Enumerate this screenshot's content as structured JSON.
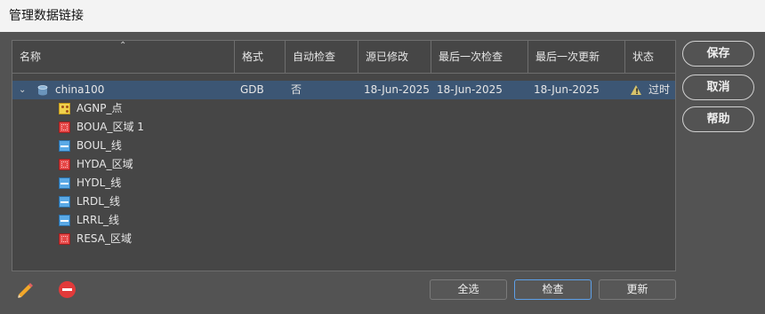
{
  "window": {
    "title": "管理数据链接"
  },
  "table": {
    "columns": [
      {
        "label": "名称"
      },
      {
        "label": "格式"
      },
      {
        "label": "自动检查"
      },
      {
        "label": "源已修改"
      },
      {
        "label": "最后一次检查"
      },
      {
        "label": "最后一次更新"
      },
      {
        "label": "状态"
      }
    ],
    "parent": {
      "name": "china100",
      "format": "GDB",
      "auto_check": "否",
      "source_modified": "18-Jun-2025",
      "last_check": "18-Jun-2025",
      "last_update": "18-Jun-2025",
      "status": "过时",
      "icon": "database-icon",
      "status_icon": "warning-icon",
      "expanded": true
    },
    "children": [
      {
        "name": "AGNP_点",
        "icon": "point-layer-icon"
      },
      {
        "name": "BOUA_区域 1",
        "icon": "area-layer-icon"
      },
      {
        "name": "BOUL_线",
        "icon": "line-layer-icon"
      },
      {
        "name": "HYDA_区域",
        "icon": "area-layer-icon"
      },
      {
        "name": "HYDL_线",
        "icon": "line-layer-icon"
      },
      {
        "name": "LRDL_线",
        "icon": "line-layer-icon"
      },
      {
        "name": "LRRL_线",
        "icon": "line-layer-icon"
      },
      {
        "name": "RESA_区域",
        "icon": "area-layer-icon"
      }
    ]
  },
  "side_buttons": {
    "save": "保存",
    "cancel": "取消",
    "help": "帮助"
  },
  "bottom_buttons": {
    "select_all": "全选",
    "check": "检查",
    "update": "更新"
  },
  "toolbar": {
    "edit_icon": "pencil-icon",
    "remove_icon": "remove-icon"
  },
  "colors": {
    "selection": "#3c5674",
    "dialog_bg": "#535353",
    "area_icon": "#e64848",
    "line_icon": "#5aa9e6",
    "point_icon": "#f1d24c",
    "warning": "#d7c36b"
  }
}
